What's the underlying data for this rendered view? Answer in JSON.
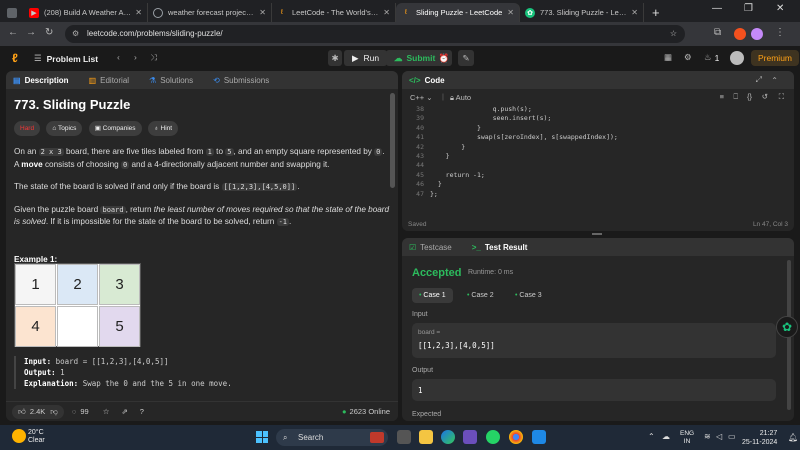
{
  "browser": {
    "tabs": [
      {
        "label": "(208) Build A Weather App in H",
        "icon": "youtube-icon",
        "color": "#ff0000"
      },
      {
        "label": "weather forecast project javasc",
        "icon": "globe-icon",
        "color": "#9aa0a6"
      },
      {
        "label": "LeetCode - The World's Leading",
        "icon": "leetcode-icon",
        "color": "#ffa116"
      },
      {
        "label": "Sliding Puzzle - LeetCode",
        "icon": "leetcode-icon",
        "color": "#ffa116"
      },
      {
        "label": "773. Sliding Puzzle - LeetCode",
        "icon": "chatgpt-icon",
        "color": "#19c37d"
      }
    ],
    "url": "leetcode.com/problems/sliding-puzzle/"
  },
  "header": {
    "problem_list": "Problem List",
    "run": "Run",
    "submit": "Submit",
    "streak": "1",
    "premium": "Premium"
  },
  "description": {
    "tabs": [
      "Description",
      "Editorial",
      "Solutions",
      "Submissions"
    ],
    "title": "773. Sliding Puzzle",
    "tags": [
      "Hard",
      "Topics",
      "Companies",
      "Hint"
    ],
    "p1_a": "On an ",
    "p1_code1": "2 x 3",
    "p1_b": " board, there are five tiles labeled from ",
    "p1_code2": "1",
    "p1_c": " to ",
    "p1_code3": "5",
    "p1_d": ", and an empty square represented by ",
    "p1_code4": "0",
    "p1_e": ". A ",
    "p1_bold": "move",
    "p1_f": " consists of choosing ",
    "p1_code5": "0",
    "p1_g": " and a 4-directionally adjacent number and swapping it.",
    "p2_a": "The state of the board is solved if and only if the board is ",
    "p2_code": "[[1,2,3],[4,5,0]]",
    "p2_b": ".",
    "p3_a": "Given the puzzle board ",
    "p3_code1": "board",
    "p3_b": ", return ",
    "p3_italic": "the least number of moves required so that the state of the board is solved",
    "p3_c": ". If it is impossible for the state of the board to be solved, return ",
    "p3_code2": "-1",
    "p3_d": ".",
    "example_title": "Example 1:",
    "grid": [
      "1",
      "2",
      "3",
      "4",
      "",
      "5"
    ],
    "grid_colors": [
      "#f5f5f5",
      "#dbe8f6",
      "#d8ead3",
      "#fce4d0",
      "#ffffff",
      "#e2d9ee"
    ],
    "input_label": "Input:",
    "input_value": " board = [[1,2,3],[4,0,5]]",
    "output_label": "Output:",
    "output_value": " 1",
    "explanation_label": "Explanation:",
    "explanation_value": " Swap the 0 and the 5 in one move.",
    "likes": "2.4K",
    "comments": "99",
    "online": "2623 Online"
  },
  "code": {
    "title": "Code",
    "language": "C++",
    "mode": "Auto",
    "lines": [
      {
        "n": "38",
        "t": "                q.push(s);"
      },
      {
        "n": "39",
        "t": "                seen.insert(s);"
      },
      {
        "n": "40",
        "t": "            }"
      },
      {
        "n": "41",
        "t": "            swap(s[zeroIndex], s[swappedIndex]);"
      },
      {
        "n": "42",
        "t": "        }"
      },
      {
        "n": "43",
        "t": "    }"
      },
      {
        "n": "44",
        "t": ""
      },
      {
        "n": "45",
        "t": "    return -1;"
      },
      {
        "n": "46",
        "t": "  }"
      },
      {
        "n": "47",
        "t": "};"
      }
    ],
    "status": "Saved",
    "position": "Ln 47, Col 3"
  },
  "result": {
    "tabs": [
      "Testcase",
      "Test Result"
    ],
    "verdict": "Accepted",
    "runtime": "Runtime: 0 ms",
    "cases": [
      "Case 1",
      "Case 2",
      "Case 3"
    ],
    "input_label": "Input",
    "input_var": "board =",
    "input_value": "[[1,2,3],[4,0,5]]",
    "output_label": "Output",
    "output_value": "1",
    "expected_label": "Expected"
  },
  "taskbar": {
    "temp": "20°C",
    "weather": "Clear",
    "search": "Search",
    "lang1": "ENG",
    "lang2": "IN",
    "time": "21:27",
    "date": "25-11-2024"
  }
}
